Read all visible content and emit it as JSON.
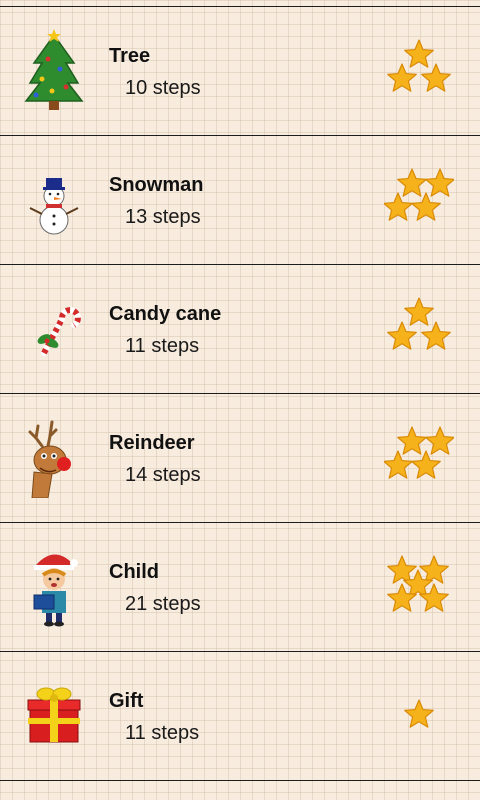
{
  "levels": [
    {
      "icon": "christmas-tree-icon",
      "title": "Tree",
      "steps": "10 steps",
      "stars": 3
    },
    {
      "icon": "snowman-icon",
      "title": "Snowman",
      "steps": "13 steps",
      "stars": 4
    },
    {
      "icon": "candy-cane-icon",
      "title": "Candy cane",
      "steps": "11 steps",
      "stars": 3
    },
    {
      "icon": "reindeer-icon",
      "title": "Reindeer",
      "steps": "14 steps",
      "stars": 4
    },
    {
      "icon": "child-icon",
      "title": "Child",
      "steps": "21 steps",
      "stars": 5
    },
    {
      "icon": "gift-icon",
      "title": "Gift",
      "steps": "11 steps",
      "stars": 1
    }
  ],
  "colors": {
    "background": "#f7ecde",
    "divider": "#1d1d1d",
    "star_fill": "#f6b21a",
    "star_stroke": "#d98a07"
  }
}
